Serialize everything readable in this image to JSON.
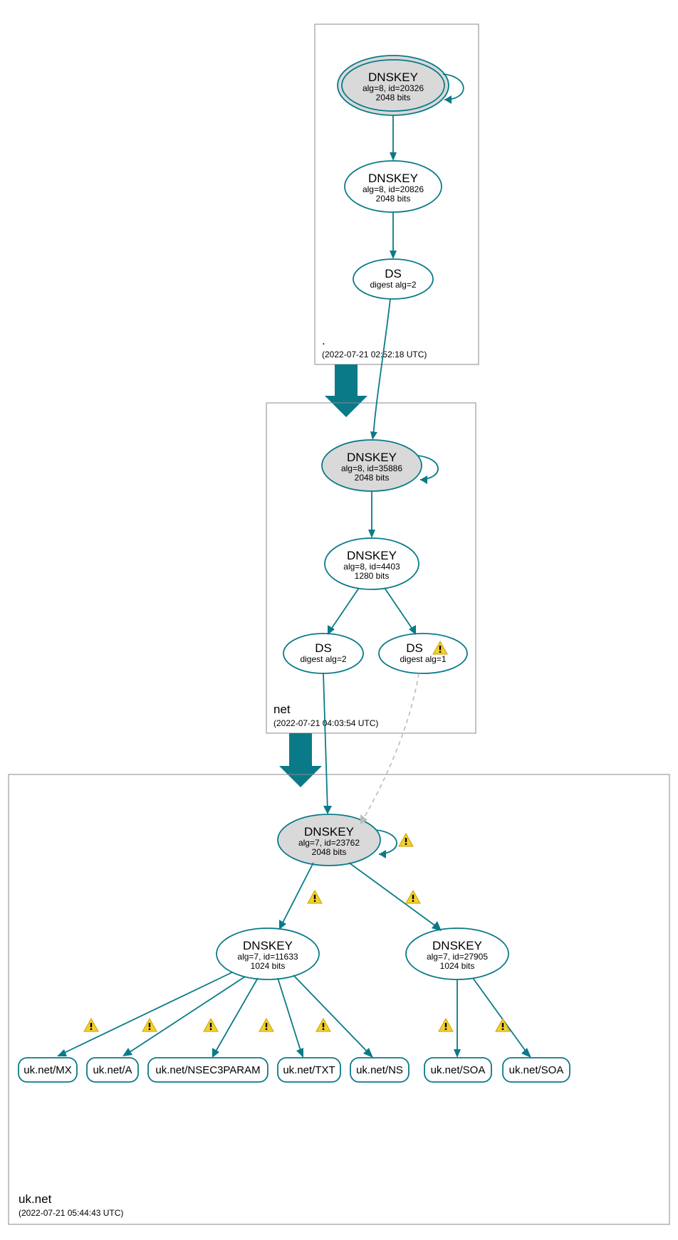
{
  "zones": {
    "root": {
      "label": ".",
      "time": "(2022-07-21 02:52:18 UTC)"
    },
    "net": {
      "label": "net",
      "time": "(2022-07-21 04:03:54 UTC)"
    },
    "uknet": {
      "label": "uk.net",
      "time": "(2022-07-21 05:44:43 UTC)"
    }
  },
  "nodes": {
    "root_ksk": {
      "title": "DNSKEY",
      "l1": "alg=8, id=20326",
      "l2": "2048 bits"
    },
    "root_zsk": {
      "title": "DNSKEY",
      "l1": "alg=8, id=20826",
      "l2": "2048 bits"
    },
    "root_ds": {
      "title": "DS",
      "l1": "digest alg=2"
    },
    "net_ksk": {
      "title": "DNSKEY",
      "l1": "alg=8, id=35886",
      "l2": "2048 bits"
    },
    "net_zsk": {
      "title": "DNSKEY",
      "l1": "alg=8, id=4403",
      "l2": "1280 bits"
    },
    "net_ds2": {
      "title": "DS",
      "l1": "digest alg=2"
    },
    "net_ds1": {
      "title": "DS",
      "l1": "digest alg=1"
    },
    "uk_ksk": {
      "title": "DNSKEY",
      "l1": "alg=7, id=23762",
      "l2": "2048 bits"
    },
    "uk_zsk1": {
      "title": "DNSKEY",
      "l1": "alg=7, id=11633",
      "l2": "1024 bits"
    },
    "uk_zsk2": {
      "title": "DNSKEY",
      "l1": "alg=7, id=27905",
      "l2": "1024 bits"
    }
  },
  "rr": {
    "mx": "uk.net/MX",
    "a": "uk.net/A",
    "nsec3": "uk.net/NSEC3PARAM",
    "txt": "uk.net/TXT",
    "ns": "uk.net/NS",
    "soa1": "uk.net/SOA",
    "soa2": "uk.net/SOA"
  }
}
